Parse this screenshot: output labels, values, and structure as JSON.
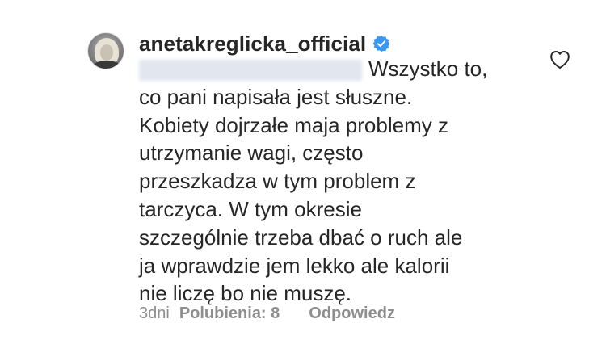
{
  "comment": {
    "username": "anetakreglicka_official",
    "verified": true,
    "verified_icon": "verified-badge-icon",
    "mention_redacted": true,
    "text_lines": [
      "Wszystko to,",
      "co pani napisała jest słuszne.",
      "Kobiety dojrzałe maja problemy z",
      "utrzymanie wagi, często",
      "przeszkadza w tym problem z",
      "tarczyca. W tym okresie",
      "szczególnie trzeba dbać o ruch ale",
      "ja wprawdzie jem lekko ale kalorii",
      "nie liczę bo nie muszę."
    ],
    "like_icon": "heart-outline-icon",
    "meta": {
      "time": "3dni",
      "likes": "Polubienia: 8",
      "reply": "Odpowiedz"
    }
  },
  "colors": {
    "text": "#262626",
    "meta": "#8e8e8e",
    "verified_blue": "#3897f0",
    "background": "#ffffff"
  }
}
